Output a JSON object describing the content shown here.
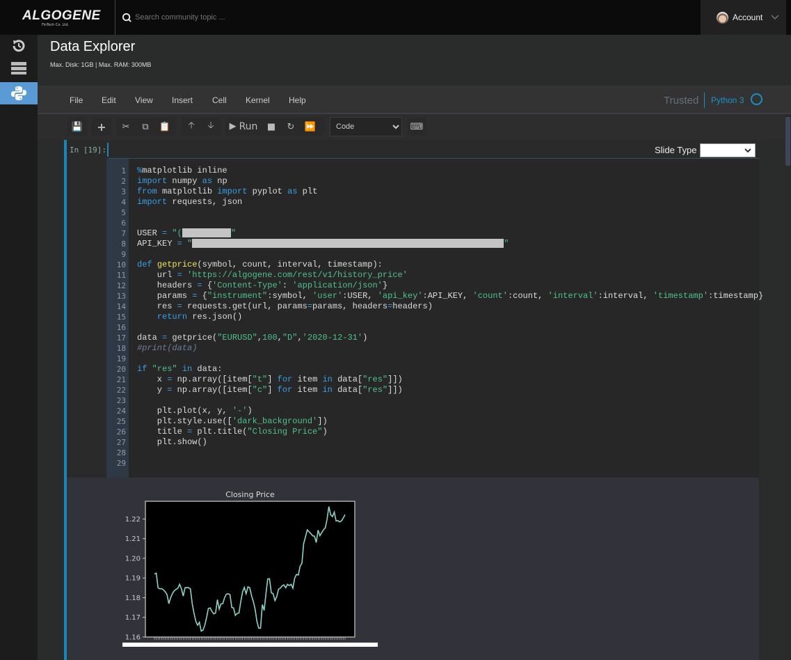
{
  "brand": {
    "name": "ALGOGENE",
    "tagline": "FinTech Co. Ltd."
  },
  "search": {
    "placeholder": "Search community topic ..."
  },
  "account": {
    "label": "Account"
  },
  "sidebar": {
    "items": [
      {
        "icon": "history-icon"
      },
      {
        "icon": "server-icon"
      },
      {
        "icon": "python-icon",
        "active": true
      }
    ],
    "active_color": "#5b9bd5"
  },
  "header": {
    "title": "Data Explorer",
    "subtitle": "Max. Disk: 1GB | Max. RAM: 300MB"
  },
  "menu": {
    "items": [
      "File",
      "Edit",
      "View",
      "Insert",
      "Cell",
      "Kernel",
      "Help"
    ],
    "trusted": "Trusted",
    "kernel": "Python 3"
  },
  "toolbar": {
    "run_label": "Run",
    "cell_type": "Code"
  },
  "cell": {
    "prompt": "In [19]:",
    "slide_type_label": "Slide Type",
    "slide_type_value": "",
    "lines": [
      [
        [
          "%",
          "kw"
        ],
        [
          "matplotlib inline",
          ""
        ]
      ],
      [
        [
          "import",
          "kw"
        ],
        [
          " numpy ",
          ""
        ],
        [
          "as",
          "kw"
        ],
        [
          " np",
          ""
        ]
      ],
      [
        [
          "from",
          "kw"
        ],
        [
          " matplotlib ",
          ""
        ],
        [
          "import",
          "kw"
        ],
        [
          " pyplot ",
          ""
        ],
        [
          "as",
          "kw"
        ],
        [
          " plt",
          ""
        ]
      ],
      [
        [
          "import",
          "kw"
        ],
        [
          " requests, json",
          ""
        ]
      ],
      [],
      [],
      [
        [
          "USER ",
          ""
        ],
        [
          "=",
          "kw"
        ],
        [
          " \"(",
          "st"
        ],
        [
          "REDACT_SHORT",
          "redact"
        ],
        [
          "\"",
          "st"
        ]
      ],
      [
        [
          "API_KEY ",
          ""
        ],
        [
          "=",
          "kw"
        ],
        [
          " \"",
          "st"
        ],
        [
          "REDACT_LONG",
          "redact"
        ],
        [
          "\"",
          "st"
        ]
      ],
      [],
      [
        [
          "def",
          "kw"
        ],
        [
          " ",
          ""
        ],
        [
          "getprice",
          "fn"
        ],
        [
          "(symbol, count, interval, timestamp):",
          ""
        ]
      ],
      [
        [
          "    url ",
          ""
        ],
        [
          "=",
          "kw"
        ],
        [
          " ",
          ""
        ],
        [
          "'https://algogene.com/rest/v1/history_price'",
          "st"
        ]
      ],
      [
        [
          "    headers ",
          ""
        ],
        [
          "=",
          "kw"
        ],
        [
          " {",
          ""
        ],
        [
          "'Content-Type'",
          "st"
        ],
        [
          ": ",
          ""
        ],
        [
          "'application/json'",
          "st"
        ],
        [
          "}",
          ""
        ]
      ],
      [
        [
          "    params ",
          ""
        ],
        [
          "=",
          "kw"
        ],
        [
          " {",
          ""
        ],
        [
          "\"instrument\"",
          "st"
        ],
        [
          ":symbol, ",
          ""
        ],
        [
          "'user'",
          "st"
        ],
        [
          ":USER, ",
          ""
        ],
        [
          "'api_key'",
          "st"
        ],
        [
          ":API_KEY, ",
          ""
        ],
        [
          "'count'",
          "st"
        ],
        [
          ":count, ",
          ""
        ],
        [
          "'interval'",
          "st"
        ],
        [
          ":interval, ",
          ""
        ],
        [
          "'timestamp'",
          "st"
        ],
        [
          ":timestamp}",
          ""
        ]
      ],
      [
        [
          "    res ",
          ""
        ],
        [
          "=",
          "kw"
        ],
        [
          " requests.get(url, params",
          ""
        ],
        [
          "=",
          "kw"
        ],
        [
          "params, headers",
          ""
        ],
        [
          "=",
          "kw"
        ],
        [
          "headers)",
          ""
        ]
      ],
      [
        [
          "    ",
          ""
        ],
        [
          "return",
          "kw"
        ],
        [
          " res.json()",
          ""
        ]
      ],
      [],
      [
        [
          "data ",
          ""
        ],
        [
          "=",
          "kw"
        ],
        [
          " getprice(",
          ""
        ],
        [
          "\"EURUSD\"",
          "st"
        ],
        [
          ",",
          ""
        ],
        [
          "100",
          "nm"
        ],
        [
          ",",
          ""
        ],
        [
          "\"D\"",
          "st"
        ],
        [
          ",",
          ""
        ],
        [
          "'2020-12-31'",
          "st"
        ],
        [
          ")",
          ""
        ]
      ],
      [
        [
          "#print(data)",
          "cm"
        ]
      ],
      [],
      [
        [
          "if",
          "kw"
        ],
        [
          " ",
          ""
        ],
        [
          "\"res\"",
          "st"
        ],
        [
          " ",
          ""
        ],
        [
          "in",
          "kw"
        ],
        [
          " data:",
          ""
        ]
      ],
      [
        [
          "    x ",
          ""
        ],
        [
          "=",
          "kw"
        ],
        [
          " np.array([item[",
          ""
        ],
        [
          "\"t\"",
          "st"
        ],
        [
          "] ",
          ""
        ],
        [
          "for",
          "kw"
        ],
        [
          " item ",
          ""
        ],
        [
          "in",
          "kw"
        ],
        [
          " data[",
          ""
        ],
        [
          "\"res\"",
          "st"
        ],
        [
          "]])",
          ""
        ]
      ],
      [
        [
          "    y ",
          ""
        ],
        [
          "=",
          "kw"
        ],
        [
          " np.array([item[",
          ""
        ],
        [
          "\"c\"",
          "st"
        ],
        [
          "] ",
          ""
        ],
        [
          "for",
          "kw"
        ],
        [
          " item ",
          ""
        ],
        [
          "in",
          "kw"
        ],
        [
          " data[",
          ""
        ],
        [
          "\"res\"",
          "st"
        ],
        [
          "]])",
          ""
        ]
      ],
      [],
      [
        [
          "    plt.plot(x, y, ",
          ""
        ],
        [
          "'-'",
          "st"
        ],
        [
          ")",
          ""
        ]
      ],
      [
        [
          "    plt.style.use([",
          ""
        ],
        [
          "'dark_background'",
          "st"
        ],
        [
          "])",
          ""
        ]
      ],
      [
        [
          "    title ",
          ""
        ],
        [
          "=",
          "kw"
        ],
        [
          " plt.title(",
          ""
        ],
        [
          "\"Closing Price\"",
          "st"
        ],
        [
          ")",
          ""
        ]
      ],
      [
        [
          "    plt.show()",
          ""
        ]
      ],
      [],
      []
    ]
  },
  "chart_data": {
    "type": "line",
    "title": "Closing Price",
    "xlabel": "",
    "ylabel": "",
    "ylim": [
      1.16,
      1.229
    ],
    "yticks": [
      "1.16",
      "1.17",
      "1.18",
      "1.19",
      "1.20",
      "1.21",
      "1.22"
    ],
    "line_color": "#8dd3c7",
    "background": "#000000",
    "grid": false,
    "values": [
      1.192,
      1.1925,
      1.185,
      1.1845,
      1.1846,
      1.184,
      1.183,
      1.1815,
      1.177,
      1.18,
      1.182,
      1.1835,
      1.1842,
      1.1848,
      1.1868,
      1.1845,
      1.1808,
      1.185,
      1.1852,
      1.185,
      1.1845,
      1.177,
      1.172,
      1.168,
      1.166,
      1.1675,
      1.163,
      1.1635,
      1.166,
      1.17,
      1.1745,
      1.1748,
      1.173,
      1.1718,
      1.1722,
      1.179,
      1.1742,
      1.1768,
      1.177,
      1.18,
      1.1818,
      1.182,
      1.1815,
      1.175,
      1.1748,
      1.171,
      1.172,
      1.1722,
      1.178,
      1.183,
      1.1852,
      1.182,
      1.1855,
      1.185,
      1.181,
      1.178,
      1.174,
      1.168,
      1.1645,
      1.1645,
      1.1765,
      1.1735,
      1.182,
      1.1895,
      1.1896,
      1.1825,
      1.182,
      1.1785,
      1.1805,
      1.1843,
      1.1848,
      1.186,
      1.1865,
      1.185,
      1.1868,
      1.1862,
      1.1868,
      1.1848,
      1.19,
      1.1918,
      1.1915,
      1.196,
      1.1975,
      1.2075,
      1.211,
      1.2145,
      1.2135,
      1.2125,
      1.2115,
      1.2112,
      1.208,
      1.2143,
      1.2115,
      1.213,
      1.2145,
      1.2155,
      1.22,
      1.2263,
      1.2222,
      1.2212,
      1.2235,
      1.219,
      1.2192,
      1.2185,
      1.219,
      1.2205,
      1.2222
    ]
  }
}
